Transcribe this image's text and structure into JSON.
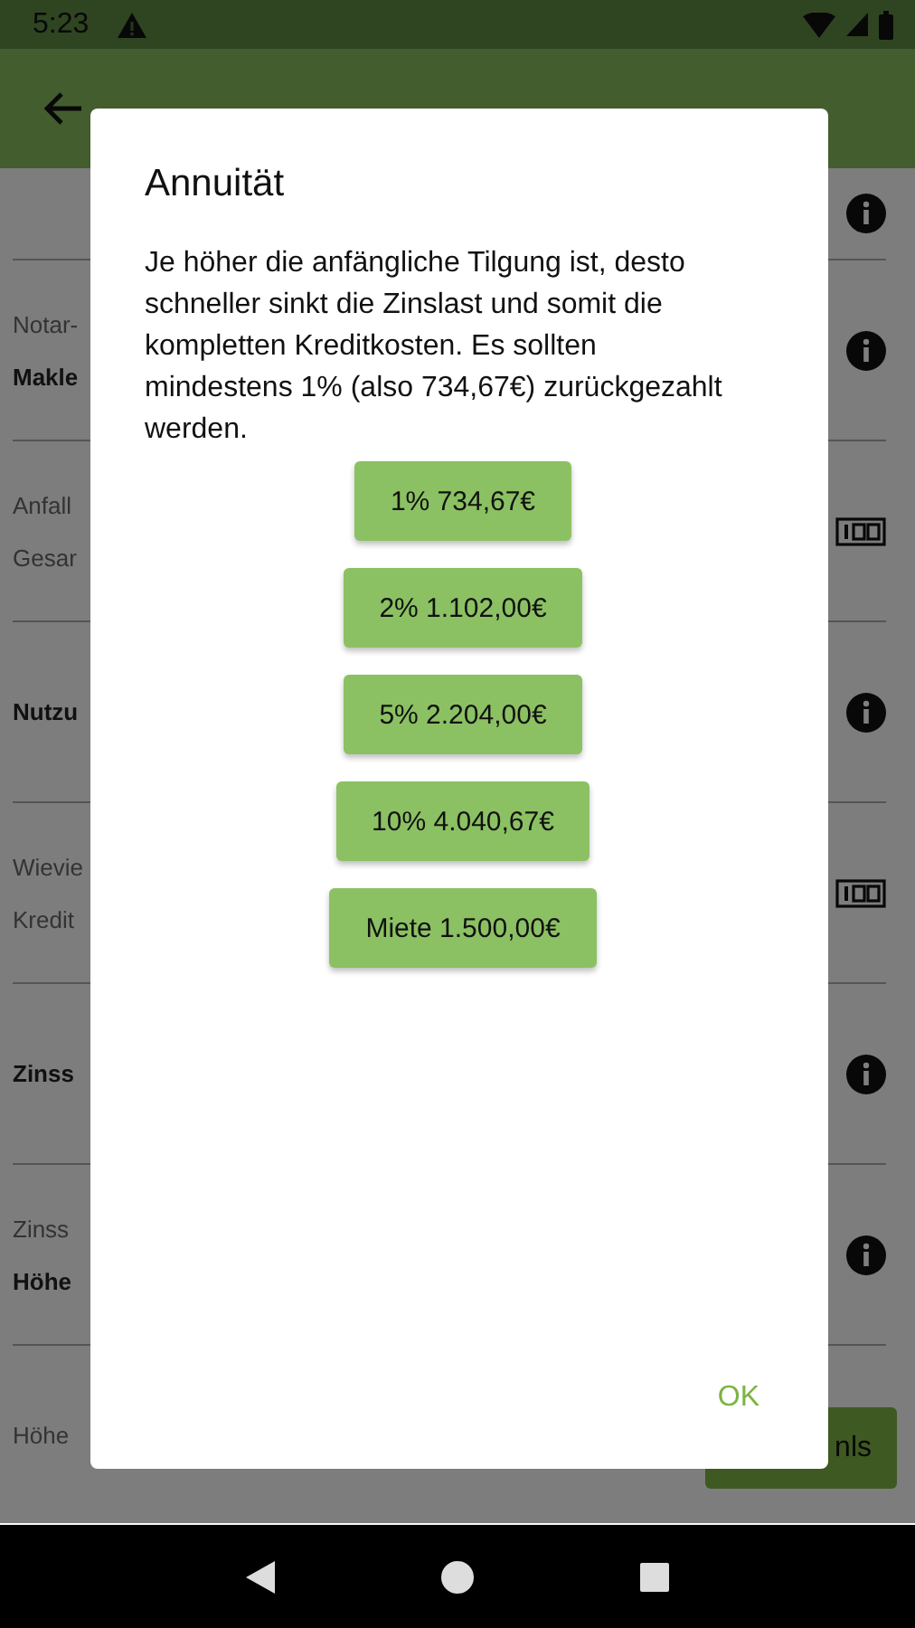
{
  "status_bar": {
    "time": "5:23"
  },
  "background": {
    "sections": [
      {
        "kind": "info"
      },
      {
        "lines": [
          {
            "text": "Notar-",
            "bold": false
          },
          {
            "text": "Makle",
            "bold": true
          }
        ],
        "kind": "info"
      },
      {
        "lines": [
          {
            "text": "Anfall",
            "bold": false
          },
          {
            "text": "Gesar",
            "bold": false
          }
        ],
        "kind": "number"
      },
      {
        "lines": [
          {
            "text": "Nutzu",
            "bold": true
          }
        ],
        "kind": "info"
      },
      {
        "lines": [
          {
            "text": "Wievie",
            "bold": false
          },
          {
            "text": "Kredit",
            "bold": false
          }
        ],
        "kind": "number"
      },
      {
        "lines": [
          {
            "text": "Zinss",
            "bold": true
          }
        ],
        "kind": "info"
      },
      {
        "lines": [
          {
            "text": "Zinss",
            "bold": false
          },
          {
            "text": "Höhe",
            "bold": true
          }
        ],
        "kind": "info"
      },
      {
        "lines": [
          {
            "text": "Höhe",
            "bold": false
          }
        ],
        "kind": "plain"
      }
    ],
    "button": "nls"
  },
  "dialog": {
    "title": "Annuität",
    "message": "Je höher die anfängliche Tilgung ist, desto schneller sinkt die Zinslast und somit die kompletten Kreditkosten. Es sollten mindestens 1% (also 734,67€) zurückgezahlt werden.",
    "options": [
      "1% 734,67€",
      "2% 1.102,00€",
      "5% 2.204,00€",
      "10% 4.040,67€",
      "Miete 1.500,00€"
    ],
    "ok": "OK"
  }
}
